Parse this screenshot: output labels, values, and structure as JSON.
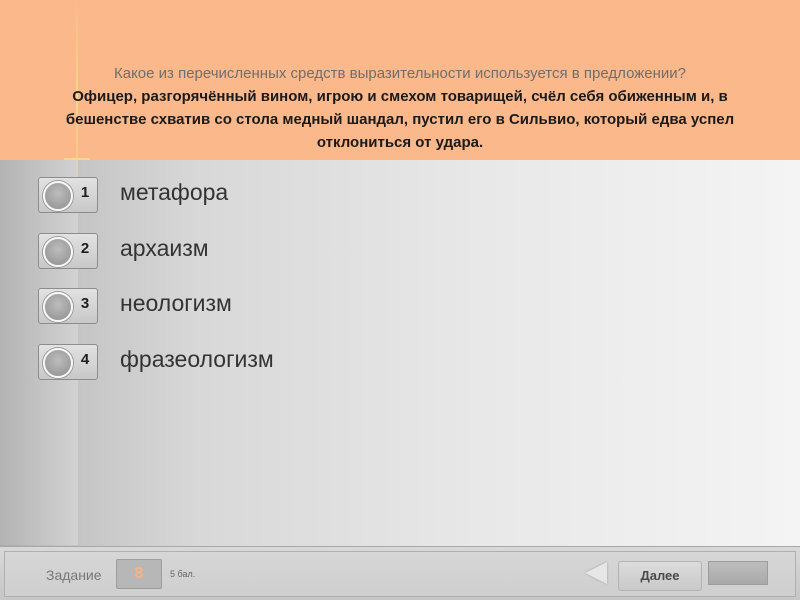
{
  "question": {
    "prompt": "Какое из перечисленных средств выразительности используется в предложении?",
    "sentence": "Офицер, разгорячённый вином, игрою и смехом товарищей, счёл себя обиженным и,  в бешенстве схватив со стола медный шандал, пустил его в Сильвио, который едва успел отклониться от удара."
  },
  "options": [
    {
      "number": "1",
      "label": "метафора"
    },
    {
      "number": "2",
      "label": "архаизм"
    },
    {
      "number": "3",
      "label": "неологизм"
    },
    {
      "number": "4",
      "label": "фразеологизм"
    }
  ],
  "footer": {
    "task_label": "Задание",
    "task_number": "8",
    "score": "5 бал.",
    "next_label": "Далее"
  },
  "colors": {
    "header_bg": "#fbb98b",
    "task_number_color": "#f6b385"
  },
  "icons": {
    "back": "back-arrow-icon",
    "radio": "radio-circle-icon"
  }
}
